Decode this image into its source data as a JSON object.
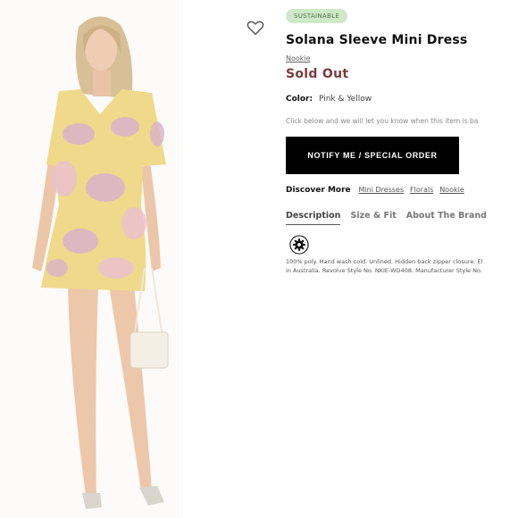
{
  "badge": "SUSTAINABLE",
  "product": {
    "title": "Solana Sleeve Mini Dress",
    "brand": "Nookie",
    "status": "Sold Out",
    "color_label": "Color:",
    "color_value": "Pink & Yellow"
  },
  "notice": "Click below and we will let you know when this item is ba",
  "notify_button": "NOTIFY ME / SPECIAL ORDER",
  "discover": {
    "label": "Discover More",
    "links": [
      "Mini Dresses",
      "Florals",
      "Nookie"
    ]
  },
  "tabs": [
    "Description",
    "Size & Fit",
    "About The Brand"
  ],
  "description": {
    "line1": "100% poly. Hand wash cold. Unlined. Hidden back zipper closure. El",
    "line2": "in Australia. Revolve Style No. NKIE-WD408. Manufacturer Style No."
  },
  "icons": {
    "wishlist": "heart-outline-icon",
    "care": "gear-icon"
  },
  "colors": {
    "status": "#7a3b3f",
    "badge_bg": "#cfe9c8",
    "button_bg": "#000000"
  }
}
